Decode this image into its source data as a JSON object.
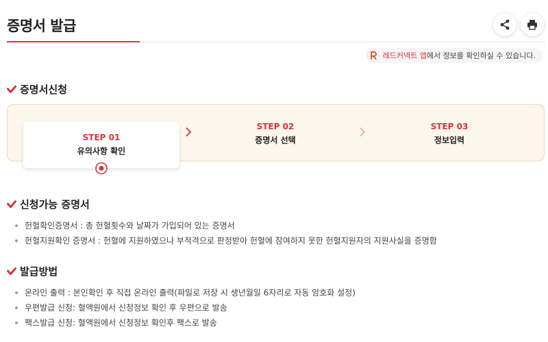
{
  "header": {
    "title": "증명서 발급",
    "share_icon": "share-icon",
    "print_icon": "printer-icon"
  },
  "notice": {
    "app_name": "레드커넥트 앱",
    "text": "에서 정보를 확인하실 수 있습니다."
  },
  "apply": {
    "heading": "증명서신청",
    "steps": [
      {
        "num": "STEP 01",
        "label": "유의사항 확인"
      },
      {
        "num": "STEP 02",
        "label": "증명서 선택"
      },
      {
        "num": "STEP 03",
        "label": "정보입력"
      }
    ]
  },
  "available": {
    "heading": "신청가능 증명서",
    "items": [
      "헌혈확인증명서 : 총 헌혈횟수와 날짜가 가입되어 있는 증명서",
      "헌혈지원확인 증명서 : 헌혈에 지원하였으나 부적격으로 판정받아 헌혈에 참여하지 못한 헌혈지원자의 지원사실을 증명함"
    ]
  },
  "method": {
    "heading": "발급방법",
    "items": [
      "온라인 출력 : 본인확인 후 직접 온라인 출력(파일로 저장 시 생년월일 6자리로 자동 암호화 설정)",
      "우편발급 신청: 혈액원에서 신청정보 확인 후 우편으로 발송",
      "팩스발급 신청: 혈액원에서 신청정보 확인후 팩스로 발송"
    ]
  },
  "colors": {
    "accent": "#d6343f",
    "step_bg": "#fcf6ec",
    "step_border": "#f0d2b8"
  }
}
